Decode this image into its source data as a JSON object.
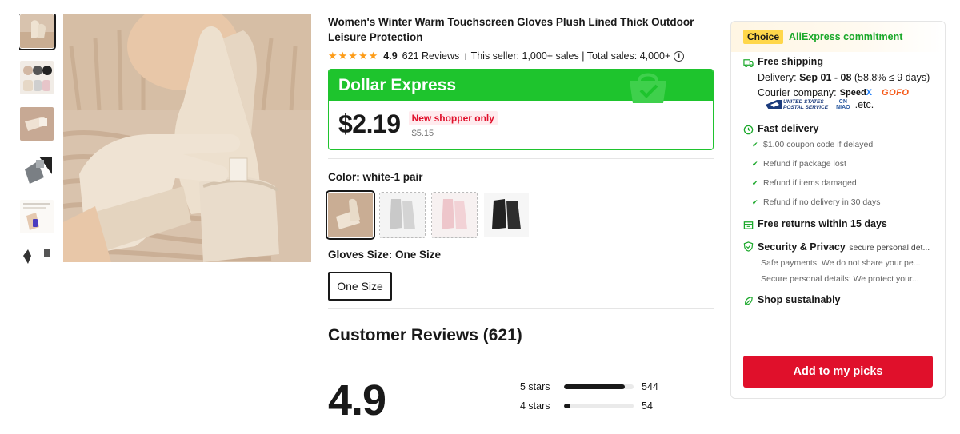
{
  "product": {
    "title": "Women's Winter Warm Touchscreen Gloves Plush Lined Thick Outdoor Leisure Protection",
    "stars": "★★★★★",
    "rating": "4.9",
    "reviews_count_text": "621 Reviews",
    "separator": "|",
    "sales_text": "This seller: 1,000+ sales | Total sales: 4,000+",
    "info_glyph": "i"
  },
  "deal": {
    "label": "Dollar Express",
    "price": "$2.19",
    "badge": "New shopper only",
    "old_price": "$5.15",
    "accent": "#1ec42d"
  },
  "variants": {
    "color_label": "Color: white-1 pair",
    "swatch_colors": [
      "white-1 pair",
      "gray",
      "pink",
      "black"
    ],
    "size_label": "Gloves Size: One Size",
    "size_option": "One Size"
  },
  "reviews": {
    "heading": "Customer Reviews (621)",
    "score": "4.9",
    "rows": [
      {
        "label": "5 stars",
        "count": "544",
        "fraction": 0.876
      },
      {
        "label": "4 stars",
        "count": "54",
        "fraction": 0.087
      }
    ]
  },
  "panel": {
    "choice_badge": "Choice",
    "commitment": "AliExpress commitment",
    "shipping": {
      "title": "Free shipping",
      "delivery_prefix": "Delivery: ",
      "delivery_dates": "Sep 01 - 08",
      "delivery_suffix": " (58.8% ≤ 9 days)",
      "courier_label": "Courier company:",
      "speedx": "Speed",
      "speedx_x": "X",
      "gofo": "GOFO",
      "usps_line1": "UNITED STATES",
      "usps_line2": "POSTAL SERVICE",
      "cn_line1": "CN",
      "cn_line2": "NIAO",
      "etc": ".etc."
    },
    "fast_delivery": {
      "title": "Fast delivery",
      "items": [
        "$1.00 coupon code if delayed",
        "Refund if package lost",
        "Refund if items damaged",
        "Refund if no delivery in 30 days"
      ]
    },
    "returns": "Free returns within 15 days",
    "security": {
      "title": "Security & Privacy",
      "title_suffix": "secure personal det...",
      "line1": "Safe payments: We do not share your pe...",
      "line2": "Secure personal details: We protect your..."
    },
    "sustain": "Shop sustainably",
    "cta": "Add to my picks",
    "cta_color": "#e0102b"
  },
  "icons": [
    "thumbnail-image",
    "glove-product-image",
    "shopping-bag-icon",
    "truck-icon",
    "clock-icon",
    "check-icon",
    "return-box-icon",
    "shield-icon",
    "leaf-icon",
    "info-icon"
  ]
}
